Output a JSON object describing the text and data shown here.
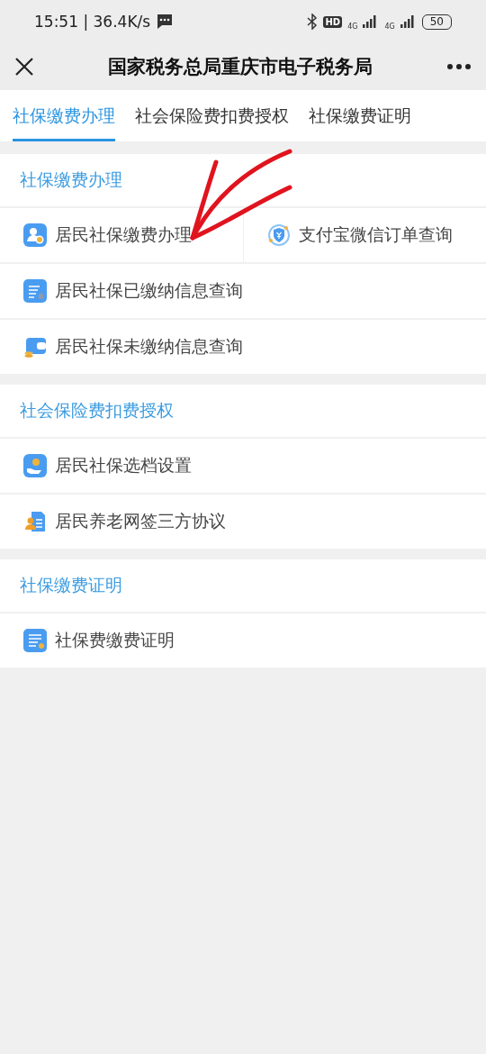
{
  "status_bar": {
    "time": "15:51 | 36.4K/s",
    "hd": "HD",
    "sim1": "4G",
    "sim2": "4G",
    "battery": "50"
  },
  "header": {
    "title": "国家税务总局重庆市电子税务局"
  },
  "tabs": [
    {
      "label": "社保缴费办理",
      "selected": true
    },
    {
      "label": "社会保险费扣费授权",
      "selected": false
    },
    {
      "label": "社保缴费证明",
      "selected": false
    }
  ],
  "sections": [
    {
      "title": "社保缴费办理",
      "rows": [
        [
          {
            "label": "居民社保缴费办理",
            "kind": "person"
          },
          {
            "label": "支付宝微信订单查询",
            "kind": "shield"
          }
        ],
        [
          {
            "label": "居民社保已缴纳信息查询",
            "kind": "document"
          }
        ],
        [
          {
            "label": "居民社保未缴纳信息查询",
            "kind": "wallet"
          }
        ]
      ]
    },
    {
      "title": "社会保险费扣费授权",
      "rows": [
        [
          {
            "label": "居民社保选档设置",
            "kind": "hand"
          }
        ],
        [
          {
            "label": "居民养老网签三方协议",
            "kind": "contract"
          }
        ]
      ]
    },
    {
      "title": "社保缴费证明",
      "rows": [
        [
          {
            "label": "社保费缴费证明",
            "kind": "list"
          }
        ]
      ]
    }
  ]
}
